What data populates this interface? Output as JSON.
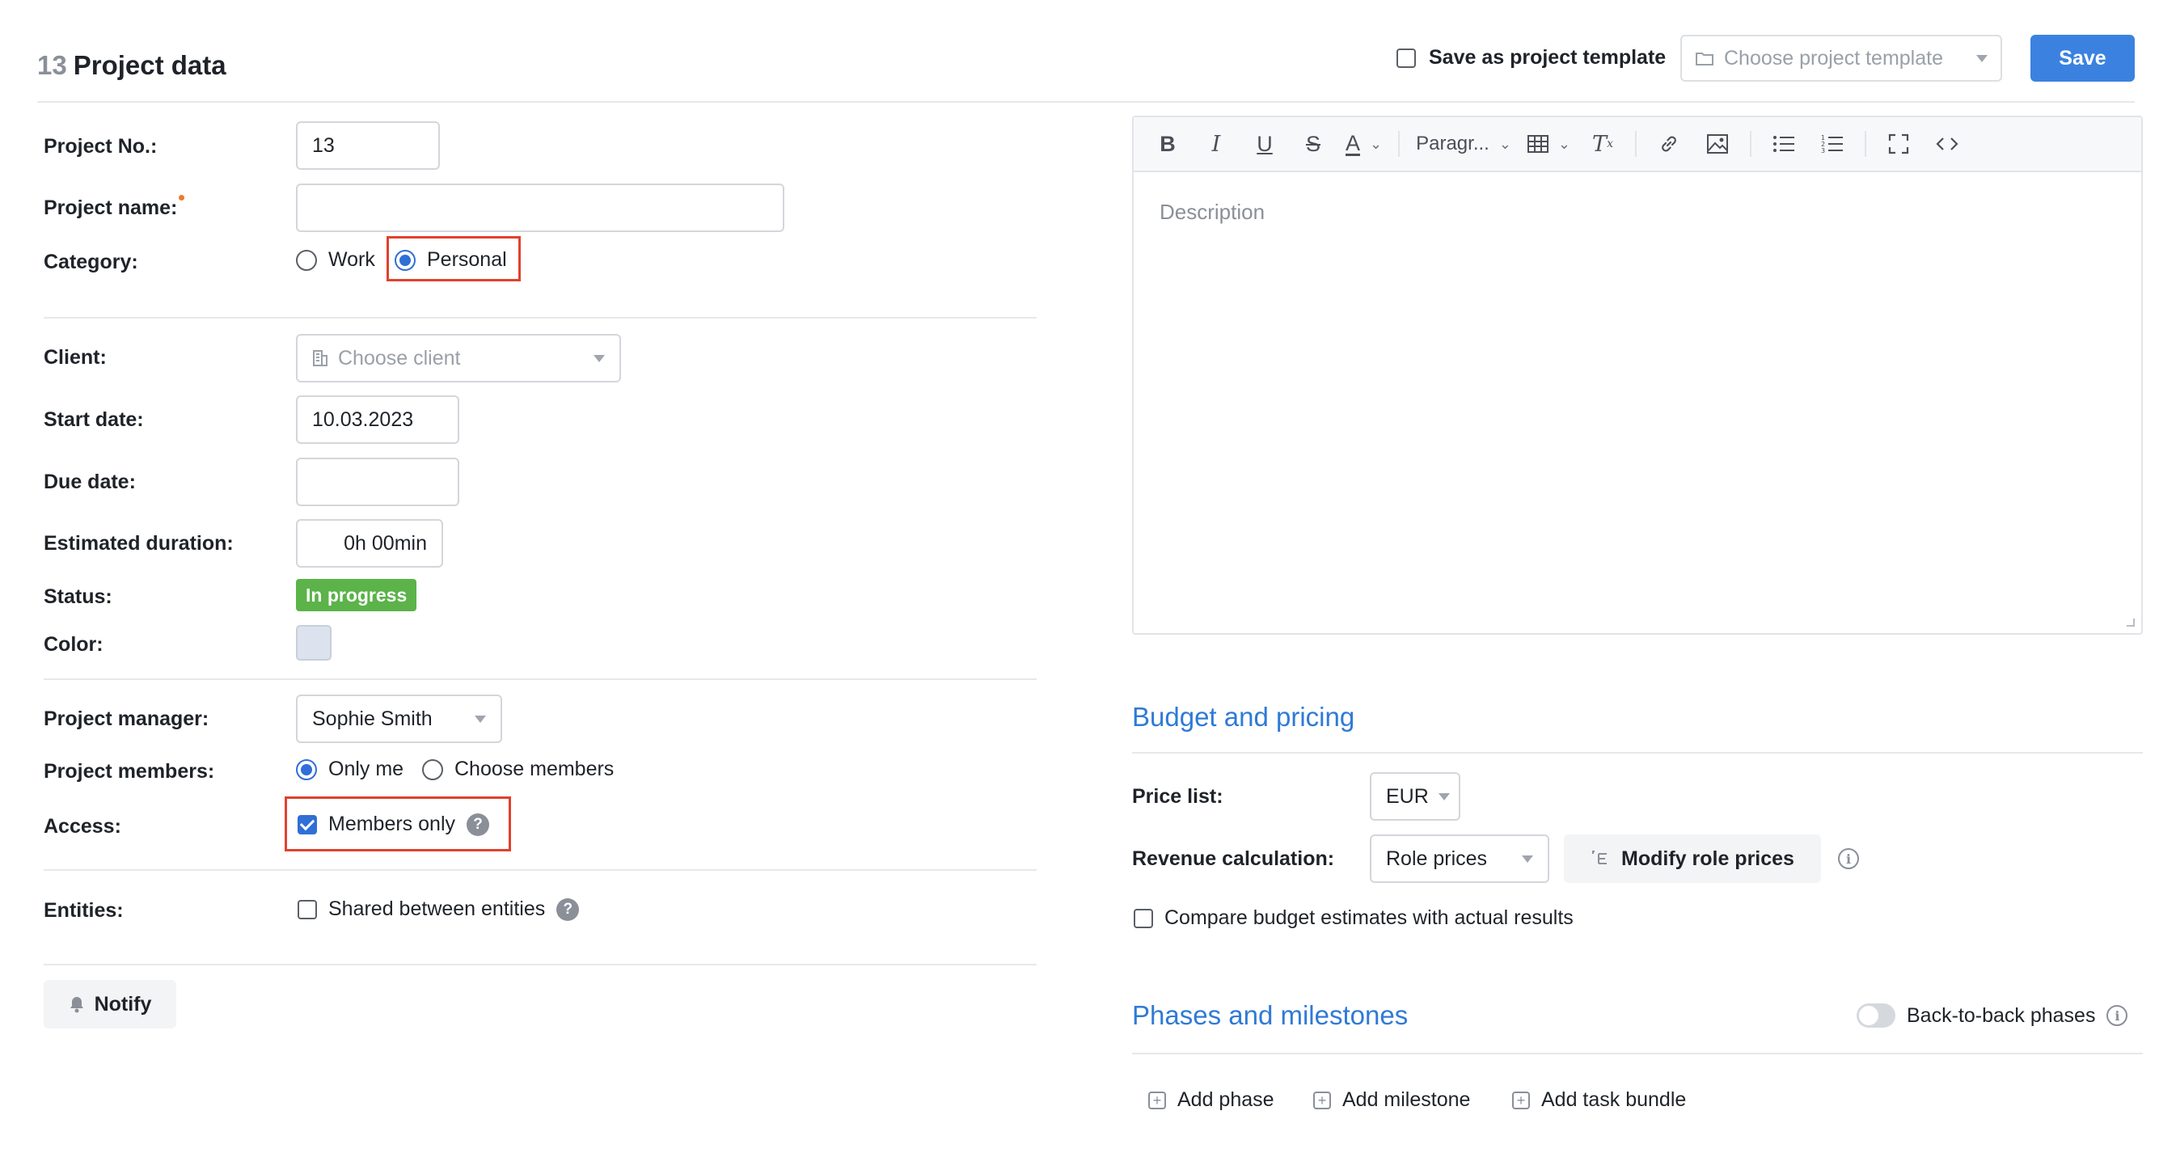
{
  "header": {
    "project_number": "13",
    "title": "Project data",
    "save_as_template_label": "Save as project template",
    "template_placeholder": "Choose project template",
    "save_label": "Save"
  },
  "form": {
    "project_no": {
      "label": "Project No.:",
      "value": "13"
    },
    "project_name": {
      "label": "Project name:",
      "value": ""
    },
    "category": {
      "label": "Category:",
      "options": [
        "Work",
        "Personal"
      ],
      "selected": "Personal"
    },
    "client": {
      "label": "Client:",
      "placeholder": "Choose client"
    },
    "start_date": {
      "label": "Start date:",
      "value": "10.03.2023"
    },
    "due_date": {
      "label": "Due date:",
      "value": ""
    },
    "estimated_duration": {
      "label": "Estimated duration:",
      "value": "0h 00min"
    },
    "status": {
      "label": "Status:",
      "value": "In progress",
      "color": "#5bb349"
    },
    "color": {
      "label": "Color:",
      "value": "#dde3ee"
    },
    "project_manager": {
      "label": "Project manager:",
      "value": "Sophie Smith"
    },
    "project_members": {
      "label": "Project members:",
      "options": [
        "Only me",
        "Choose members"
      ],
      "selected": "Only me"
    },
    "access": {
      "label": "Access:",
      "option": "Members only",
      "checked": true
    },
    "entities": {
      "label": "Entities:",
      "option": "Shared between entities",
      "checked": false
    },
    "notify_label": "Notify"
  },
  "editor": {
    "toolbar": {
      "paragraph_label": "Paragr..."
    },
    "placeholder": "Description"
  },
  "budget": {
    "title": "Budget and pricing",
    "price_list": {
      "label": "Price list:",
      "value": "EUR"
    },
    "revenue_calculation": {
      "label": "Revenue calculation:",
      "value": "Role prices"
    },
    "modify_role_prices_label": "Modify role prices",
    "compare_label": "Compare budget estimates with actual results"
  },
  "phases": {
    "title": "Phases and milestones",
    "back_to_back_label": "Back-to-back phases",
    "add_phase": "Add phase",
    "add_milestone": "Add milestone",
    "add_task_bundle": "Add task bundle"
  },
  "colors": {
    "accent": "#3b82e0",
    "section_title": "#2f7ad6",
    "highlight": "#e0412e",
    "required_dot": "#f07a2b"
  }
}
